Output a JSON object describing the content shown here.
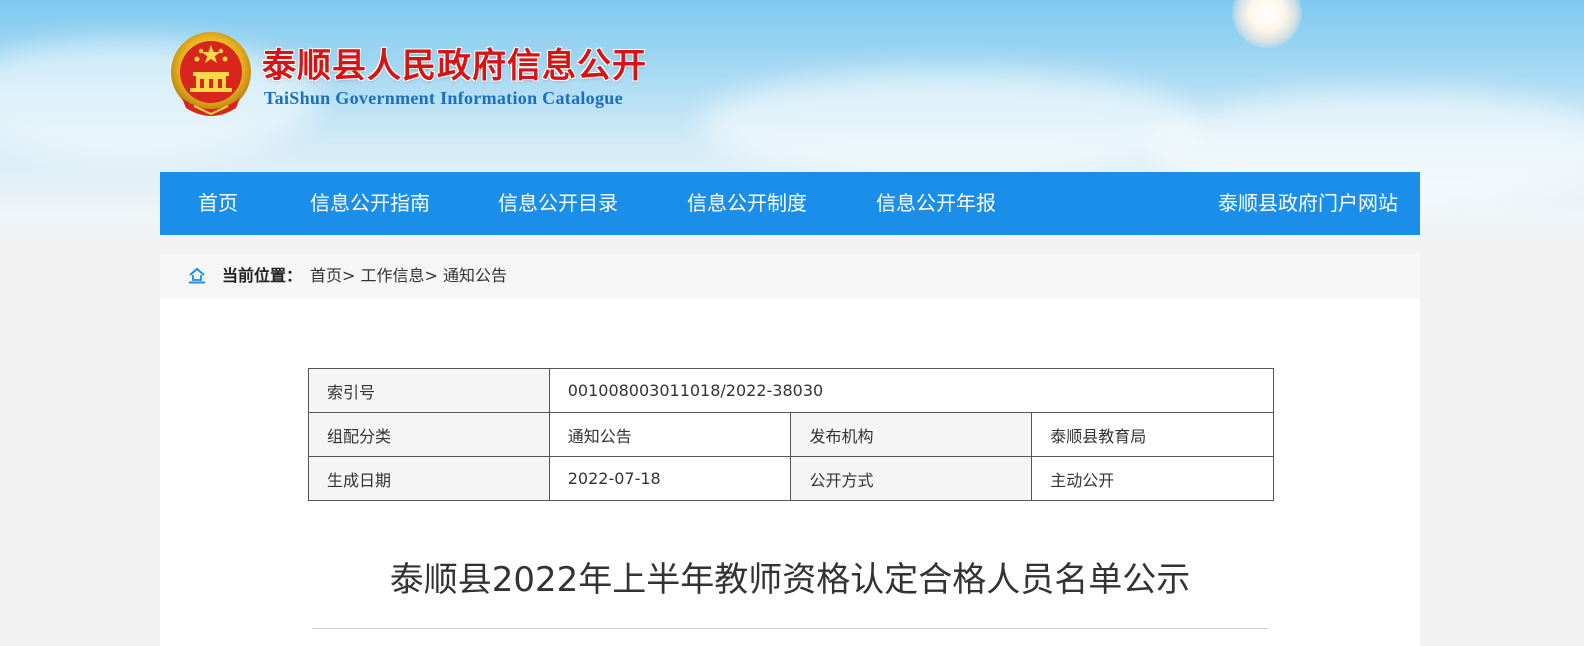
{
  "header": {
    "title": "泰顺县人民政府信息公开",
    "subtitle": "TaiShun Government Information Catalogue",
    "emblem_icon": "national-emblem-icon"
  },
  "nav": {
    "items": [
      {
        "label": "首页"
      },
      {
        "label": "信息公开指南"
      },
      {
        "label": "信息公开目录"
      },
      {
        "label": "信息公开制度"
      },
      {
        "label": "信息公开年报"
      }
    ],
    "portal_link": "泰顺县政府门户网站"
  },
  "breadcrumb": {
    "label": "当前位置：",
    "items": [
      "首页>",
      "工作信息>",
      "通知公告"
    ]
  },
  "meta": {
    "index_label": "索引号",
    "index_value": "001008003011018/2022-38030",
    "category_label": "组配分类",
    "category_value": "通知公告",
    "publisher_label": "发布机构",
    "publisher_value": "泰顺县教育局",
    "date_label": "生成日期",
    "date_value": "2022-07-18",
    "disclosure_label": "公开方式",
    "disclosure_value": "主动公开"
  },
  "article": {
    "title": "泰顺县2022年上半年教师资格认定合格人员名单公示"
  },
  "colors": {
    "nav_bg": "#1a8ee8",
    "title_red": "#d71414",
    "subtitle_blue": "#1a6fc0"
  }
}
